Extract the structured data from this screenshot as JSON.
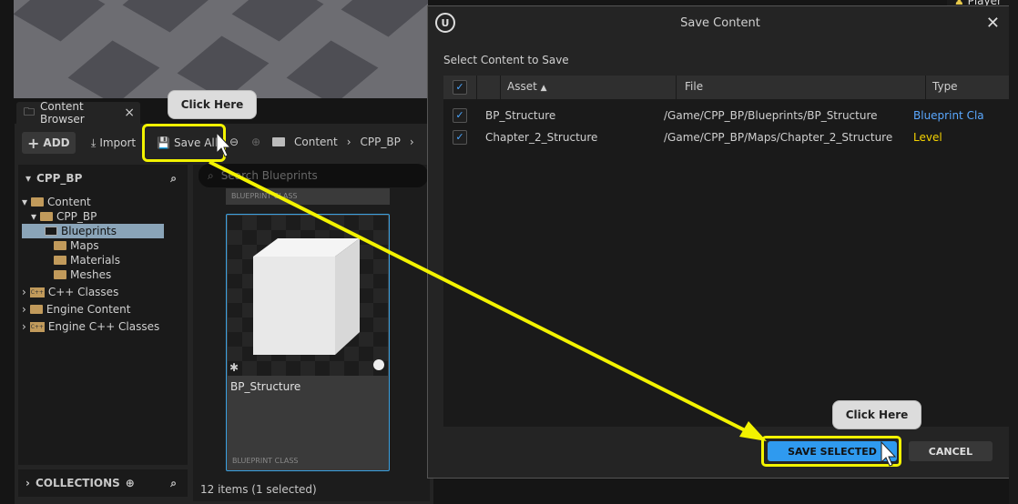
{
  "topright": {
    "label": "Player"
  },
  "content_browser": {
    "tab_label": "Content Browser",
    "toolbar": {
      "add_label": "ADD",
      "import_label": "Import",
      "save_all_label": "Save All"
    },
    "breadcrumbs": [
      "Content",
      "CPP_BP"
    ],
    "tree_header": "CPP_BP",
    "tree": [
      {
        "label": "Content",
        "type": "folder-open"
      },
      {
        "label": "CPP_BP",
        "type": "folder-open"
      },
      {
        "label": "Blueprints",
        "type": "folder",
        "selected": true
      },
      {
        "label": "Maps",
        "type": "folder"
      },
      {
        "label": "Materials",
        "type": "folder"
      },
      {
        "label": "Meshes",
        "type": "folder"
      },
      {
        "label": "C++ Classes",
        "type": "cpp"
      },
      {
        "label": "Engine Content",
        "type": "folder"
      },
      {
        "label": "Engine C++ Classes",
        "type": "cpp"
      }
    ],
    "collections_label": "COLLECTIONS",
    "search_placeholder": "Search Blueprints",
    "prev_card_class": "BLUEPRINT CLASS",
    "asset_card": {
      "name": "BP_Structure",
      "class": "BLUEPRINT CLASS"
    },
    "status": "12 items (1 selected)"
  },
  "callouts": {
    "first": "Click Here",
    "second": "Click Here"
  },
  "dialog": {
    "title": "Save Content",
    "subtitle": "Select Content to Save",
    "columns": [
      "Asset",
      "File",
      "Type"
    ],
    "rows": [
      {
        "asset": "BP_Structure",
        "file": "/Game/CPP_BP/Blueprints/BP_Structure",
        "type": "Blueprint Cla",
        "type_color": "#5aa8ff",
        "checked": true
      },
      {
        "asset": "Chapter_2_Structure",
        "file": "/Game/CPP_BP/Maps/Chapter_2_Structure",
        "type": "Level",
        "type_color": "#f5d300",
        "checked": true
      }
    ],
    "save_selected_label": "SAVE SELECTED",
    "cancel_label": "CANCEL"
  },
  "colors": {
    "highlight": "#f3f300",
    "accent": "#2f9aef"
  }
}
